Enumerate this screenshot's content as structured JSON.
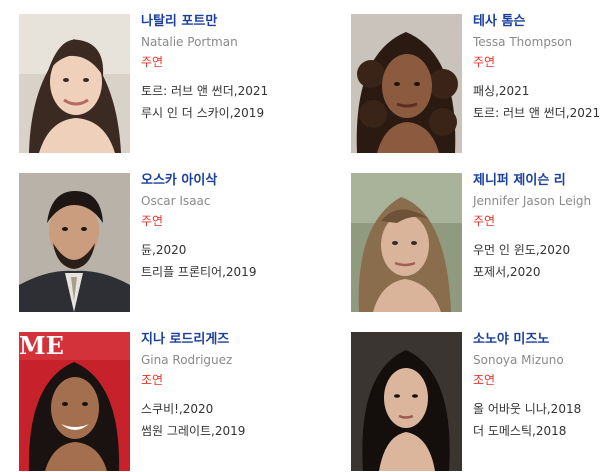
{
  "cast": [
    {
      "name_ko": "나탈리 포트만",
      "name_en": "Natalie Portman",
      "role": "주연",
      "works": [
        "토르: 러브 앤 썬더,2021",
        "루시 인 더 스카이,2019"
      ]
    },
    {
      "name_ko": "테사 톰슨",
      "name_en": "Tessa Thompson",
      "role": "주연",
      "works": [
        "패싱,2021",
        "토르: 러브 앤 썬더,2021"
      ]
    },
    {
      "name_ko": "오스카 아이삭",
      "name_en": "Oscar Isaac",
      "role": "주연",
      "works": [
        "듄,2020",
        "트리플 프론티어,2019"
      ]
    },
    {
      "name_ko": "제니퍼 제이슨 리",
      "name_en": "Jennifer Jason Leigh",
      "role": "주연",
      "works": [
        "우먼 인 윈도,2020",
        "포제서,2020"
      ]
    },
    {
      "name_ko": "지나 로드리게즈",
      "name_en": "Gina Rodriguez",
      "role": "조연",
      "works": [
        "스쿠비!,2020",
        "썸원 그레이트,2019"
      ]
    },
    {
      "name_ko": "소노야 미즈노",
      "name_en": "Sonoya Mizuno",
      "role": "조연",
      "works": [
        "올 어바웃 니나,2018",
        "더 도메스틱,2018"
      ]
    }
  ],
  "colors": {
    "name_link": "#1a3f9c",
    "english_name": "#8a8a8a",
    "role": "#e6352b",
    "work_text": "#333333"
  },
  "photo_overlay_text": "ME"
}
